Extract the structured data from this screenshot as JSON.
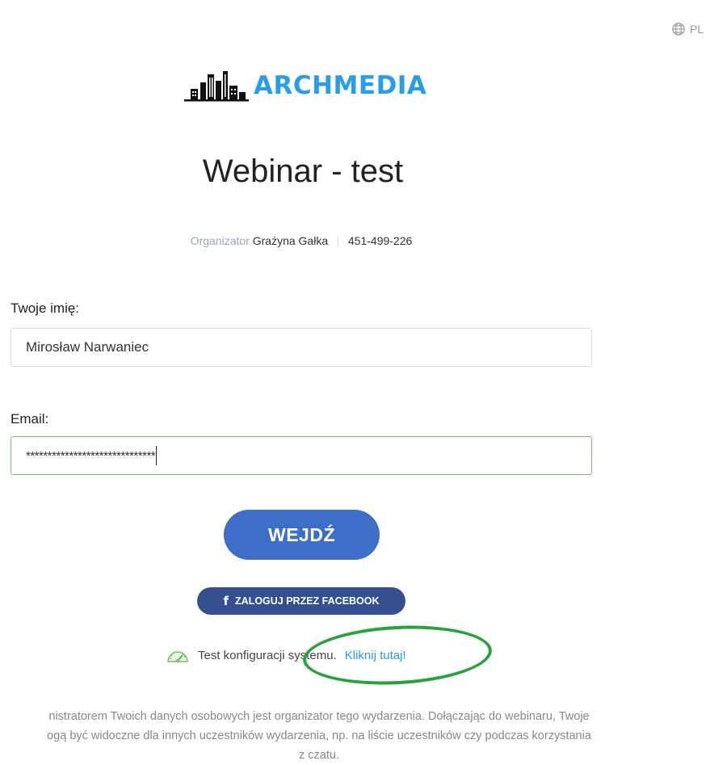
{
  "header": {
    "language": "PL",
    "language_icon": "globe-icon"
  },
  "brand": {
    "name": "ARCHMEDIA",
    "logo_icon": "city-buildings-icon",
    "color": "#2a9de8"
  },
  "event": {
    "title": "Webinar - test",
    "organizer_label": "Organizator",
    "organizer_name": "Grażyna Gałka",
    "event_id": "451-499-226"
  },
  "form": {
    "name_label": "Twoje imię:",
    "name_value": "Mirosław Narwaniec",
    "email_label": "Email:",
    "email_value": "******************************",
    "submit_label": "WEJDŹ",
    "facebook_label": "ZALOGUJ PRZEZ FACEBOOK"
  },
  "system_test": {
    "icon": "speedometer-icon",
    "text": "Test konfiguracji systemu.",
    "link": "Kliknij tutaj!"
  },
  "disclaimer": {
    "line1": "nistratorem Twoich danych osobowych jest organizator tego wydarzenia. Dołączając do webinaru, Twoje",
    "line2": "ogą być widoczne dla innych uczestników wydarzenia, np. na liście uczestników czy podczas korzystania",
    "line3": "z czatu."
  },
  "colors": {
    "primary_button": "#3d6fc9",
    "facebook_button": "#354f8f",
    "link": "#2a9de8",
    "focus_border": "#7cc46a",
    "annotation": "#2aa13a"
  }
}
